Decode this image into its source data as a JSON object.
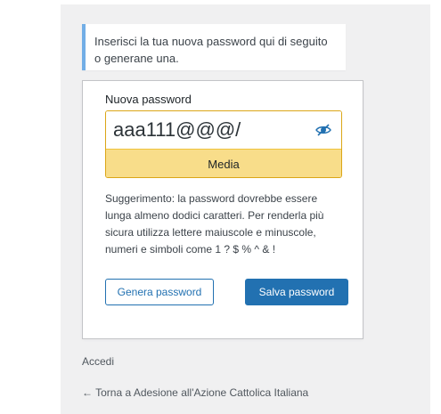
{
  "message": {
    "line1": "Inserisci la tua nuova password qui di seguito",
    "line2": "o generane una."
  },
  "form": {
    "field_label": "Nuova password",
    "password_value": "aaa111@@@/",
    "eye_icon": "eye-slash-icon",
    "strength_label": "Media",
    "hint_lines": [
      "Suggerimento: la password dovrebbe essere",
      "lunga almeno dodici caratteri. Per renderla più",
      "sicura utilizza lettere maiuscole e minuscole,",
      "numeri e simboli come 1 ? $ % ^ & !"
    ],
    "generate_label": "Genera password",
    "save_label": "Salva password"
  },
  "nav": {
    "login_label": "Accedi",
    "back_label": "← Torna a Adesione all'Azione Cattolica Italiana"
  },
  "colors": {
    "accent": "#2271b1",
    "info_border": "#72aee6",
    "strength_medium": "#f8dd8a",
    "strength_border": "#dba617",
    "page_background": "#f0f0f1"
  }
}
